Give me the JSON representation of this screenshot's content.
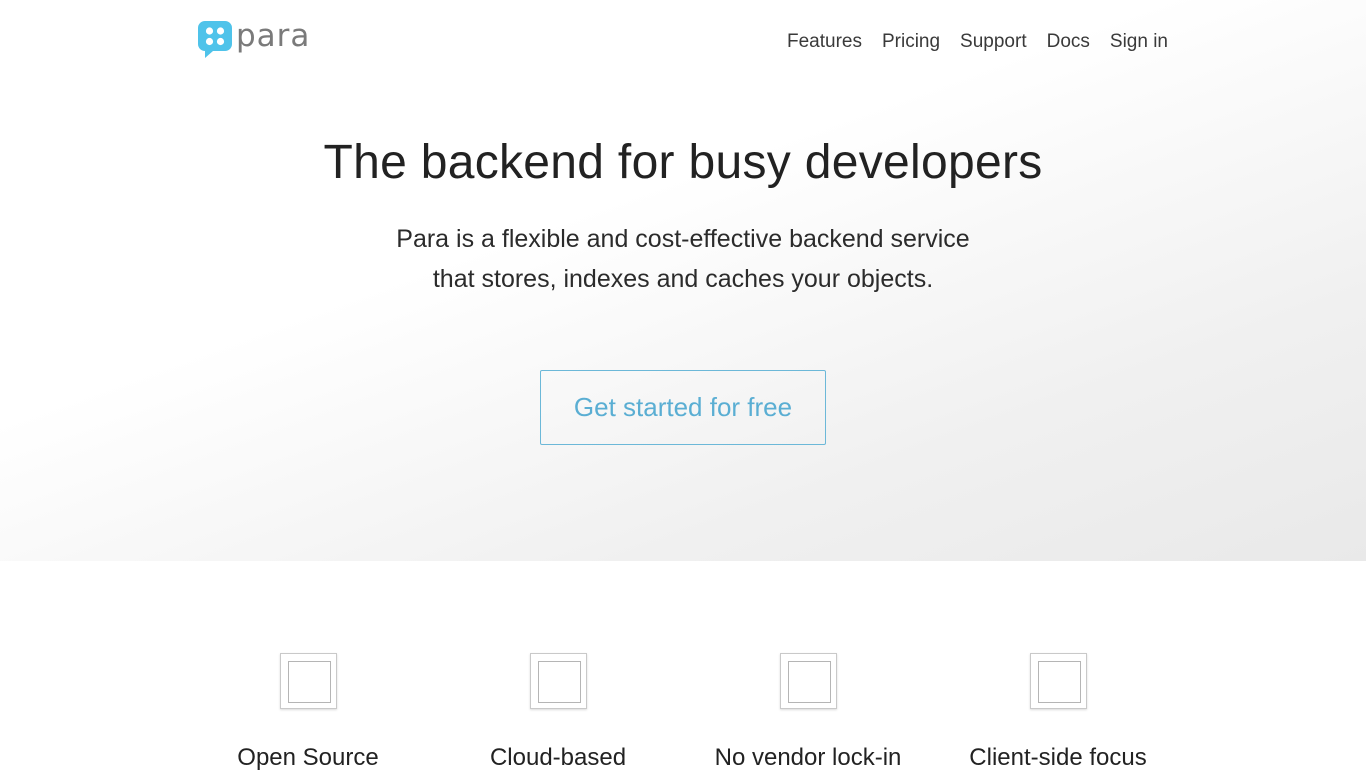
{
  "brand": {
    "name": "para",
    "color": "#4fc3ea"
  },
  "nav": {
    "items": [
      {
        "label": "Features"
      },
      {
        "label": "Pricing"
      },
      {
        "label": "Support"
      },
      {
        "label": "Docs"
      },
      {
        "label": "Sign in"
      }
    ]
  },
  "hero": {
    "headline": "The backend for busy developers",
    "sub_line1": "Para is a flexible and cost-effective backend service",
    "sub_line2": "that stores, indexes and caches your objects.",
    "cta_label": "Get started for free",
    "accent_color": "#5aaed3"
  },
  "features": {
    "items": [
      {
        "title": "Open Source",
        "icon": "feature-placeholder-icon"
      },
      {
        "title": "Cloud-based",
        "icon": "feature-placeholder-icon"
      },
      {
        "title": "No vendor lock-in",
        "icon": "feature-placeholder-icon"
      },
      {
        "title": "Client-side focus",
        "icon": "feature-placeholder-icon"
      }
    ]
  }
}
